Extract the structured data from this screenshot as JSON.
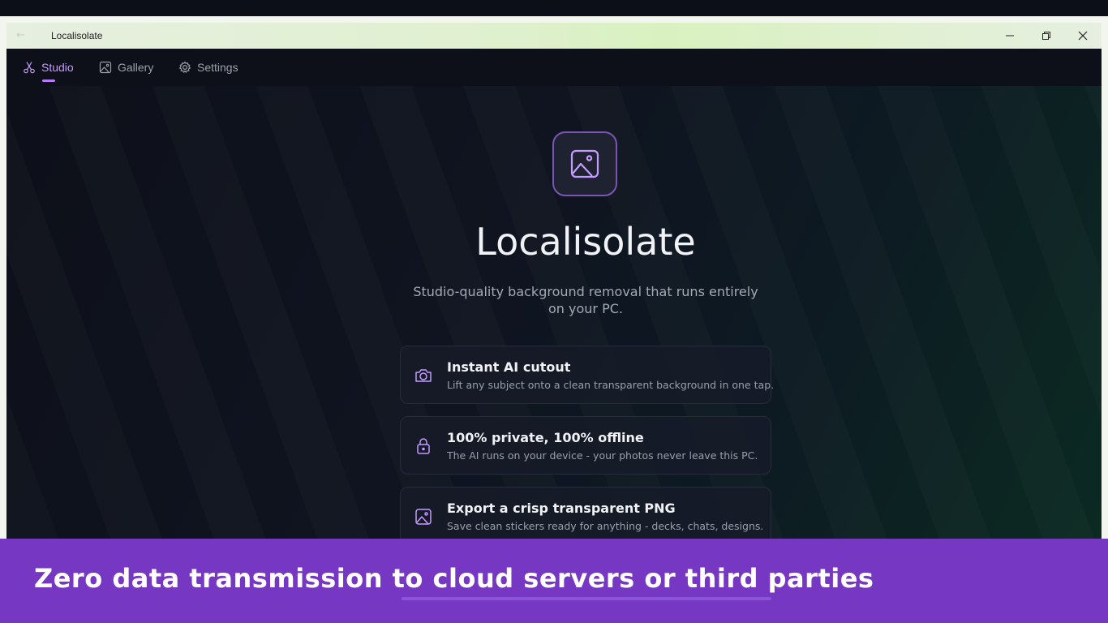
{
  "window": {
    "title": "Localisolate",
    "back_icon": "arrow-left-icon",
    "controls": [
      "minimize-icon",
      "restore-icon",
      "close-icon"
    ]
  },
  "nav": {
    "tabs": [
      {
        "label": "Studio",
        "icon": "scissors-icon",
        "active": true
      },
      {
        "label": "Gallery",
        "icon": "image-icon",
        "active": false
      },
      {
        "label": "Settings",
        "icon": "gear-icon",
        "active": false
      }
    ]
  },
  "hero": {
    "logo_icon": "image-icon",
    "app_name": "Localisolate",
    "tagline": "Studio-quality background removal that runs entirely on your PC."
  },
  "features": [
    {
      "icon": "camera-icon",
      "title": "Instant AI cutout",
      "description": "Lift any subject onto a clean transparent background in one tap."
    },
    {
      "icon": "lock-icon",
      "title": "100% private, 100% offline",
      "description": "The AI runs on your device - your photos never leave this PC."
    },
    {
      "icon": "image-icon",
      "title": "Export a crisp transparent PNG",
      "description": "Save clean stickers ready for anything - decks, chats, designs."
    }
  ],
  "banner": {
    "text": "Zero data transmission to cloud servers or third parties"
  },
  "colors": {
    "accent": "#b57cff",
    "banner": "#7638c2",
    "background": "#0f121b"
  }
}
